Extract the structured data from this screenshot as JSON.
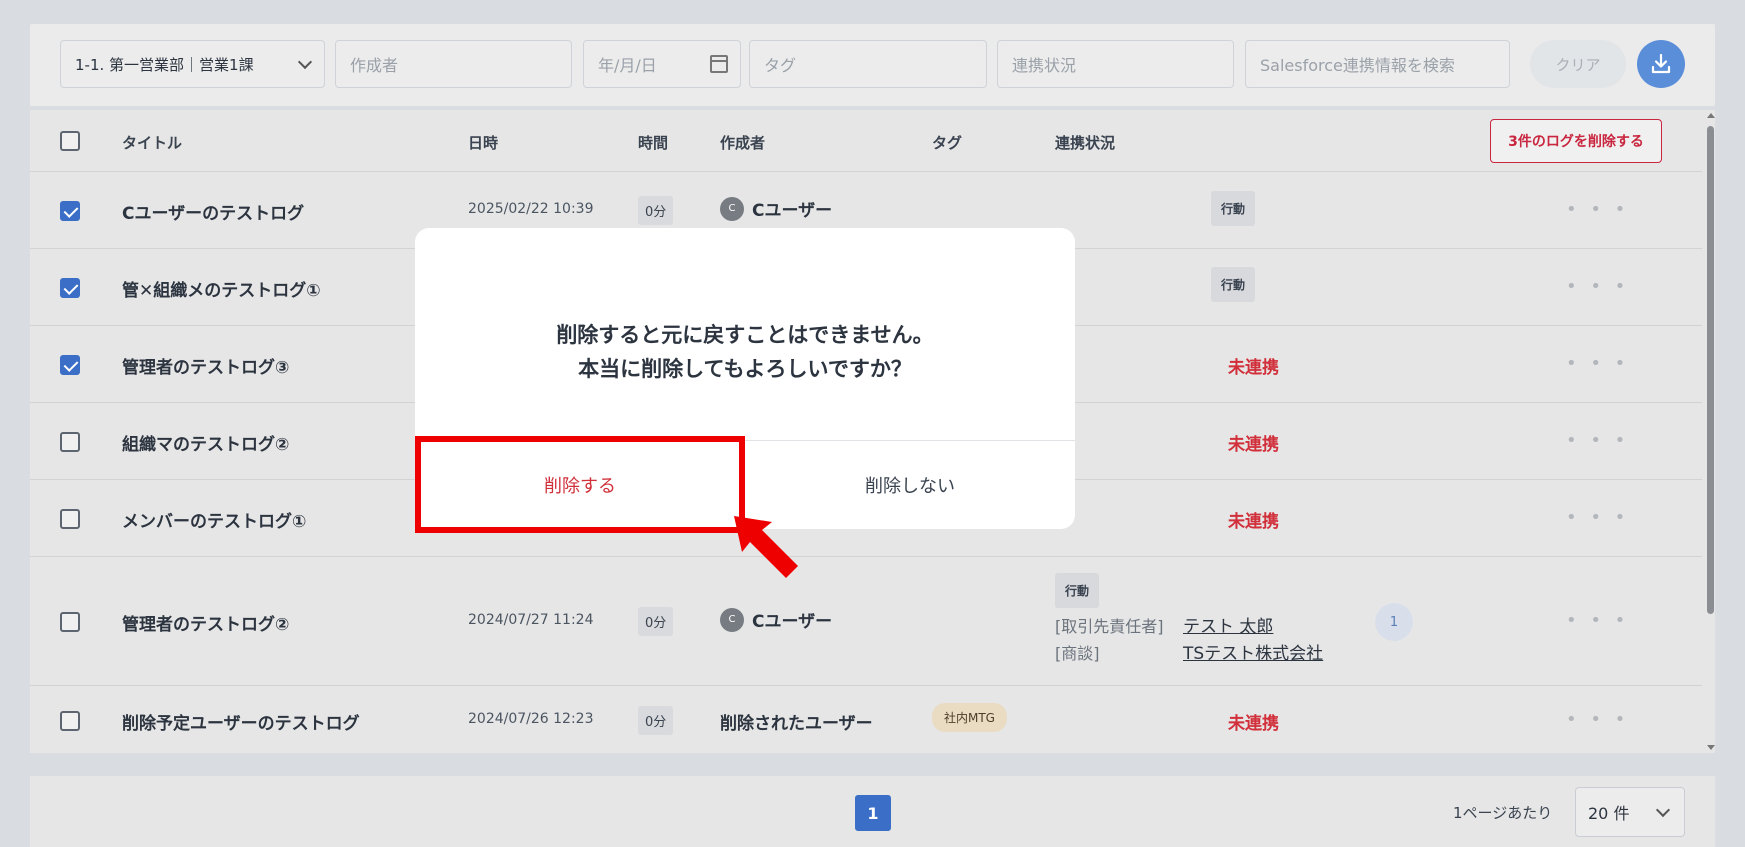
{
  "filters": {
    "department": "1-1. 第一営業部｜営業1課",
    "author_placeholder": "作成者",
    "date_placeholder": "年/月/日",
    "tag_placeholder": "タグ",
    "link_status_placeholder": "連携状況",
    "salesforce_search_placeholder": "Salesforce連携情報を検索",
    "clear_label": "クリア",
    "download_icon": "download-icon"
  },
  "table": {
    "headers": {
      "title": "タイトル",
      "datetime": "日時",
      "duration": "時間",
      "author": "作成者",
      "tag": "タグ",
      "link_status": "連携状況"
    },
    "delete_logs_label": "3件のログを削除する",
    "rows": [
      {
        "checked": true,
        "title": "Cユーザーのテストログ",
        "datetime": "2025/02/22 10:39",
        "duration": "0分",
        "author": "Cユーザー",
        "avatar": "C",
        "badge": "行動",
        "more": "• • •"
      },
      {
        "checked": true,
        "title": "管✕組織メのテストログ①",
        "badge": "行動",
        "more": "• • •"
      },
      {
        "checked": true,
        "title": "管理者のテストログ③",
        "status": "未連携",
        "more": "• • •"
      },
      {
        "checked": false,
        "title": "組織マのテストログ②",
        "status": "未連携",
        "more": "• • •"
      },
      {
        "checked": false,
        "title": "メンバーのテストログ①",
        "status": "未連携",
        "more": "• • •"
      },
      {
        "checked": false,
        "title": "管理者のテストログ②",
        "datetime": "2024/07/27 11:24",
        "duration": "0分",
        "author": "Cユーザー",
        "avatar": "C",
        "badge": "行動",
        "sf_label_1": "[取引先責任者]",
        "sf_value_1": "テスト 太郎",
        "sf_label_2": "[商談]",
        "sf_value_2": "TSテスト株式会社",
        "count": "1",
        "more": "• • •"
      },
      {
        "checked": false,
        "title": "削除予定ユーザーのテストログ",
        "datetime": "2024/07/26 12:23",
        "duration": "0分",
        "author": "削除されたユーザー",
        "tag": "社内MTG",
        "status": "未連携",
        "more": "• • •"
      }
    ]
  },
  "pagination": {
    "current_page": "1",
    "per_page_label": "1ページあたり",
    "per_page_value": "20 件"
  },
  "modal": {
    "message_line1": "削除すると元に戻すことはできません。",
    "message_line2": "本当に削除してもよろしいですか？",
    "confirm_label": "削除する",
    "cancel_label": "削除しない"
  },
  "colors": {
    "accent": "#3b6fc7",
    "danger": "#d12f3a",
    "highlight": "#ee0000"
  }
}
